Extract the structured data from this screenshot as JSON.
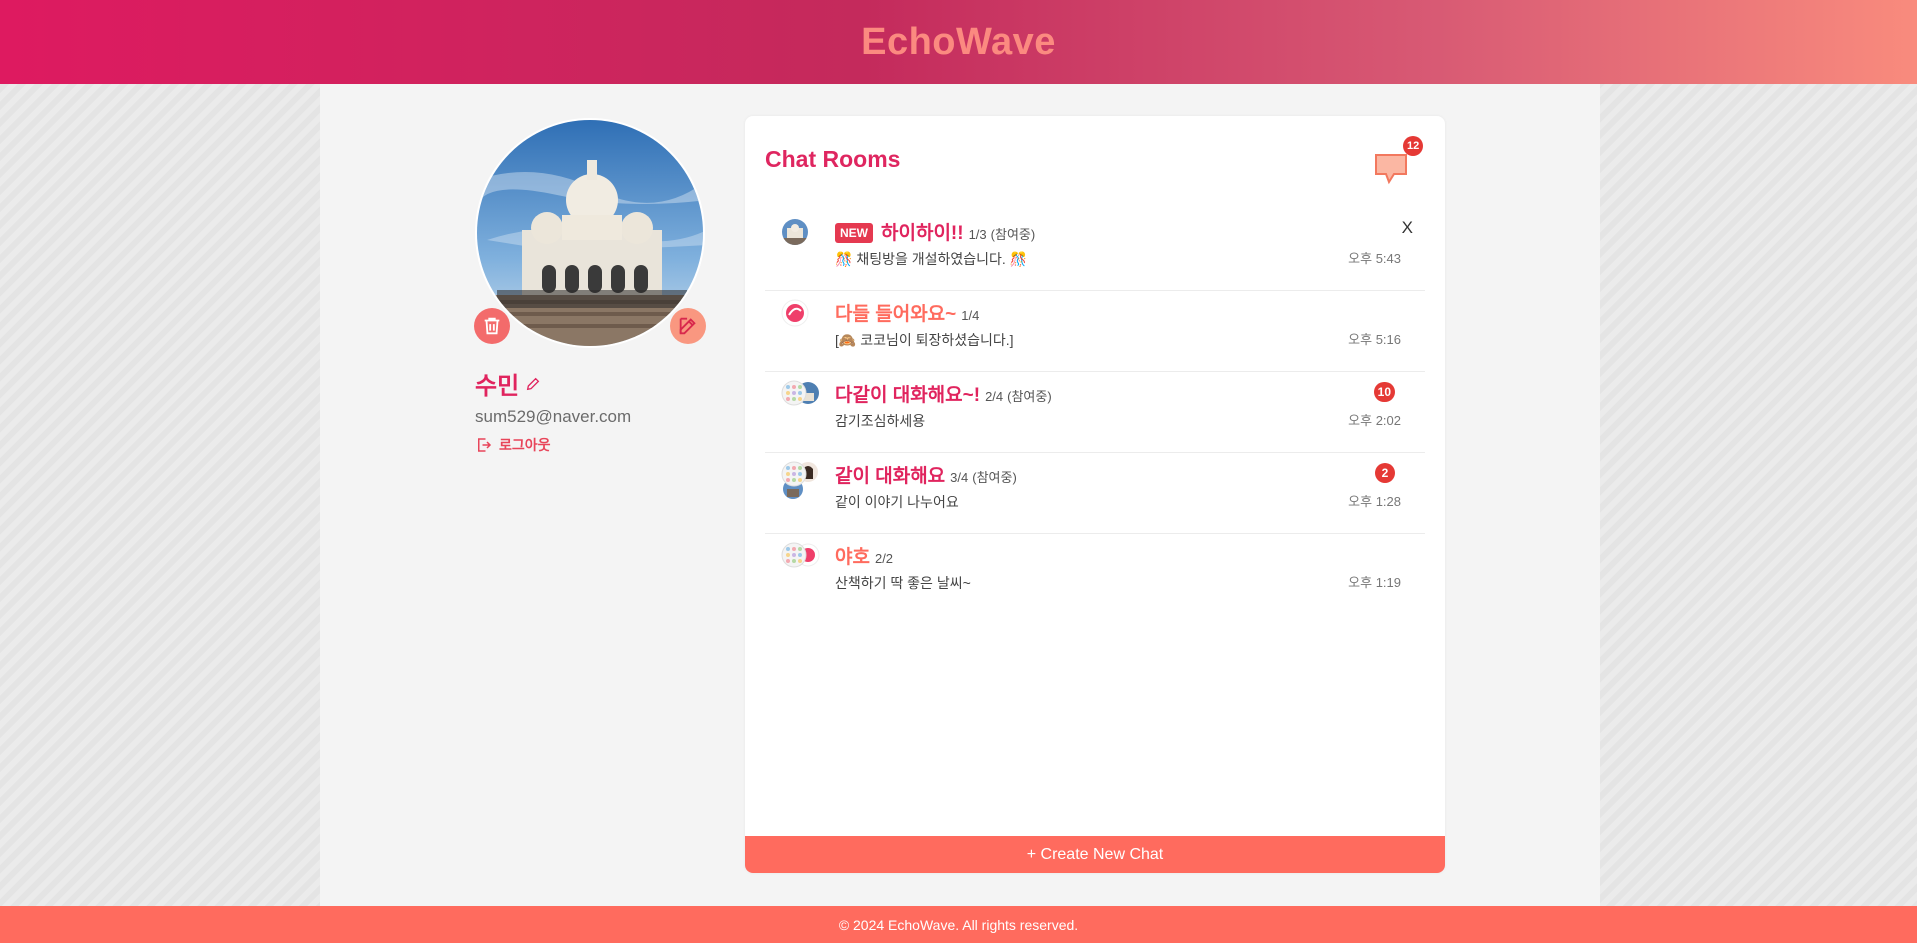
{
  "header": {
    "title": "EchoWave"
  },
  "profile": {
    "name": "수민",
    "email": "sum529@naver.com",
    "logout_label": "로그아웃"
  },
  "chat_panel": {
    "title": "Chat Rooms",
    "message_badge": "12",
    "rooms": [
      {
        "name": "하이하이!!",
        "name_color": "#e0245e",
        "is_new": true,
        "new_label": "NEW",
        "count": "1/3",
        "status": "(참여중)",
        "last_message": "🎊 채팅방을 개설하였습니다. 🎊",
        "time": "오후 5:43",
        "unread": "",
        "close": "X",
        "thumb": "photo"
      },
      {
        "name": "다들 들어와요~",
        "name_color": "#ff6b5e",
        "is_new": false,
        "count": "1/4",
        "status": "",
        "last_message": "[🙈 코코님이 퇴장하셨습니다.]",
        "time": "오후 5:16",
        "unread": "",
        "thumb": "logo"
      },
      {
        "name": "다같이 대화해요~!",
        "name_color": "#e0245e",
        "is_new": false,
        "count": "2/4",
        "status": "(참여중)",
        "last_message": "감기조심하세용",
        "time": "오후 2:02",
        "unread": "10",
        "thumb": "group2"
      },
      {
        "name": "같이 대화해요",
        "name_color": "#e0245e",
        "is_new": false,
        "count": "3/4",
        "status": "(참여중)",
        "last_message": "같이 이야기 나누어요",
        "time": "오후 1:28",
        "unread": "2",
        "thumb": "group3"
      },
      {
        "name": "야호",
        "name_color": "#ff6b5e",
        "is_new": false,
        "count": "2/2",
        "status": "",
        "last_message": "산책하기 딱 좋은 날씨~",
        "time": "오후 1:19",
        "unread": "",
        "thumb": "group2b"
      }
    ],
    "create_label": "+ Create New Chat"
  },
  "footer": {
    "text": "© 2024 EchoWave. All rights reserved."
  },
  "colors": {
    "brand": "#e0245e",
    "accent": "#ff6b5e",
    "badge": "#e53935"
  },
  "icons": [
    "trash-icon",
    "edit-icon",
    "pencil-icon",
    "logout-icon",
    "chat-bubble-icon"
  ]
}
